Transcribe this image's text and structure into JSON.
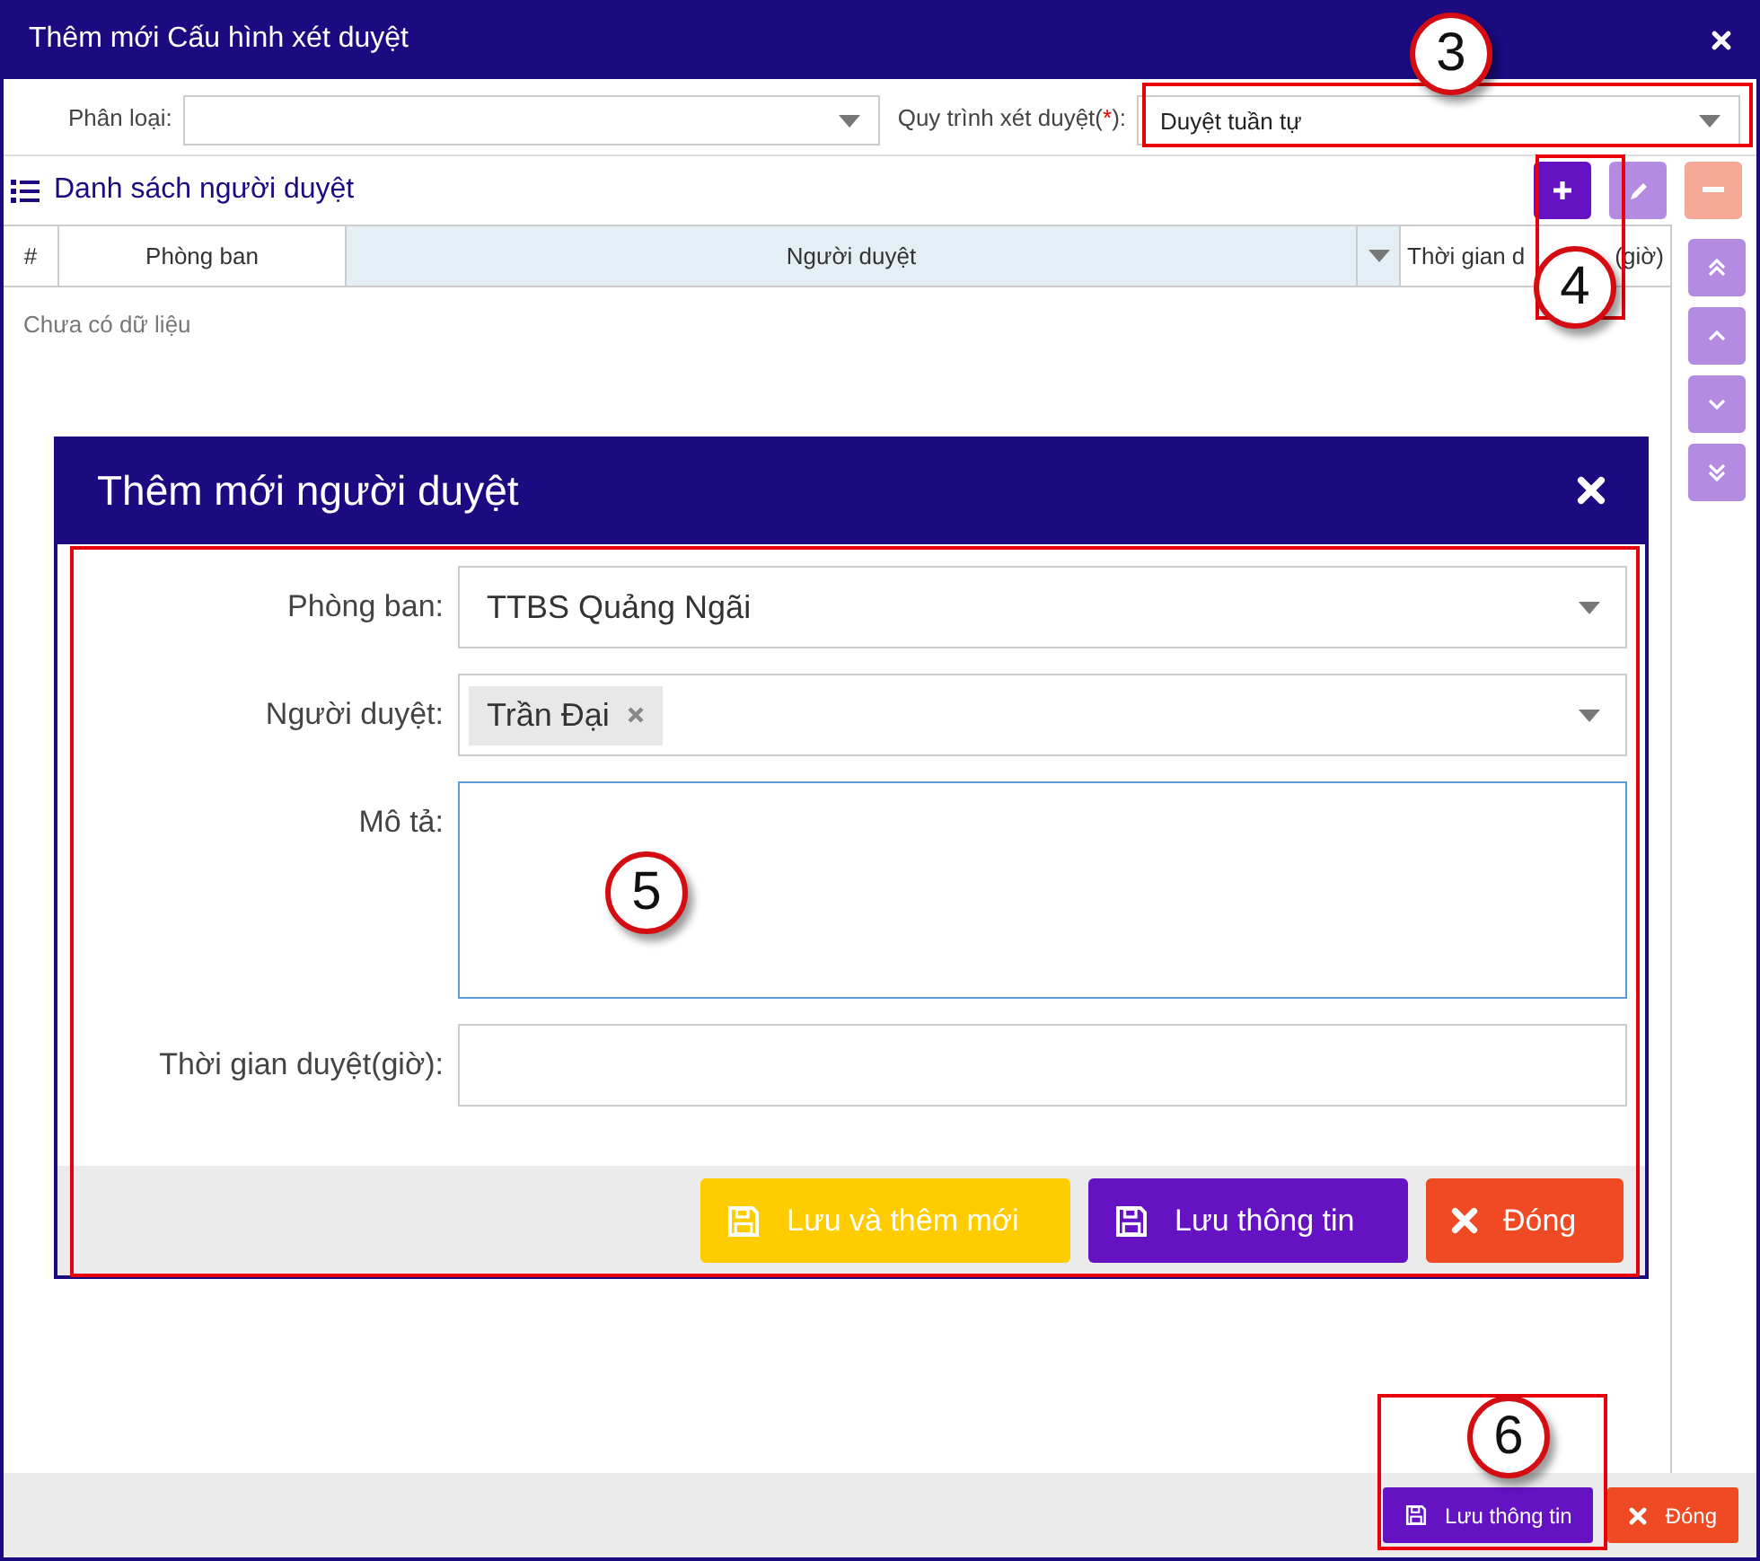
{
  "window": {
    "title": "Thêm mới Cấu hình xét duyệt"
  },
  "filters": [
    {
      "label": "Phân loại:"
    },
    {
      "label": "Quy trình xét duyệt(",
      "required_mark": "*",
      "label_end": "):",
      "value": "Duyệt tuần tự"
    }
  ],
  "list": {
    "title": "Danh sách người duyệt",
    "toolbar": [
      {
        "kind": "add",
        "disabled": false
      },
      {
        "kind": "edit",
        "disabled": true
      },
      {
        "kind": "remove",
        "disabled": true
      }
    ],
    "columns": [
      {
        "label": "#",
        "selected": false
      },
      {
        "label": "Phòng ban",
        "selected": false
      },
      {
        "label": "Người duyệt",
        "selected": true
      },
      {
        "label": "Thời gian d",
        "label_end": "(giờ)",
        "selected": false
      }
    ],
    "empty_text": "Chưa có dữ liệu",
    "move_buttons": [
      {
        "kind": "top"
      },
      {
        "kind": "up"
      },
      {
        "kind": "down"
      },
      {
        "kind": "bottom"
      }
    ]
  },
  "dialog": {
    "title": "Thêm mới người duyệt",
    "fields": [
      {
        "kind": "select",
        "label": "Phòng ban:",
        "value": "TTBS Quảng Ngãi"
      },
      {
        "kind": "multiselect",
        "label": "Người duyệt:",
        "tags": [
          "Trần Đại"
        ]
      },
      {
        "kind": "textarea",
        "label": "Mô tả:",
        "focused": true
      },
      {
        "kind": "text",
        "label": "Thời gian duyệt(giờ):",
        "focused": false
      }
    ],
    "buttons": [
      {
        "kind": "save_new",
        "label": "Lưu và thêm mới"
      },
      {
        "kind": "save",
        "label": "Lưu thông tin"
      },
      {
        "kind": "close",
        "label": "Đóng"
      }
    ]
  },
  "footer_buttons": [
    {
      "kind": "save",
      "label": "Lưu thông tin"
    },
    {
      "kind": "close",
      "label": "Đóng"
    }
  ],
  "annotations": [
    {
      "number": "3"
    },
    {
      "number": "4"
    },
    {
      "number": "5"
    },
    {
      "number": "6"
    }
  ]
}
